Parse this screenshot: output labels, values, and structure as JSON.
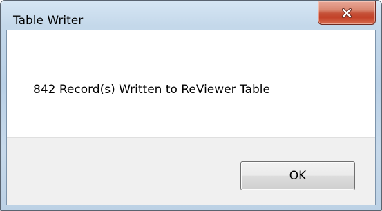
{
  "window": {
    "title": "Table Writer"
  },
  "title_bar": {
    "close_icon": "close-x-icon",
    "close_button_color": "#c75035"
  },
  "message": {
    "text": "842 Record(s) Written to ReViewer Table"
  },
  "buttons": {
    "ok_label": "OK"
  }
}
